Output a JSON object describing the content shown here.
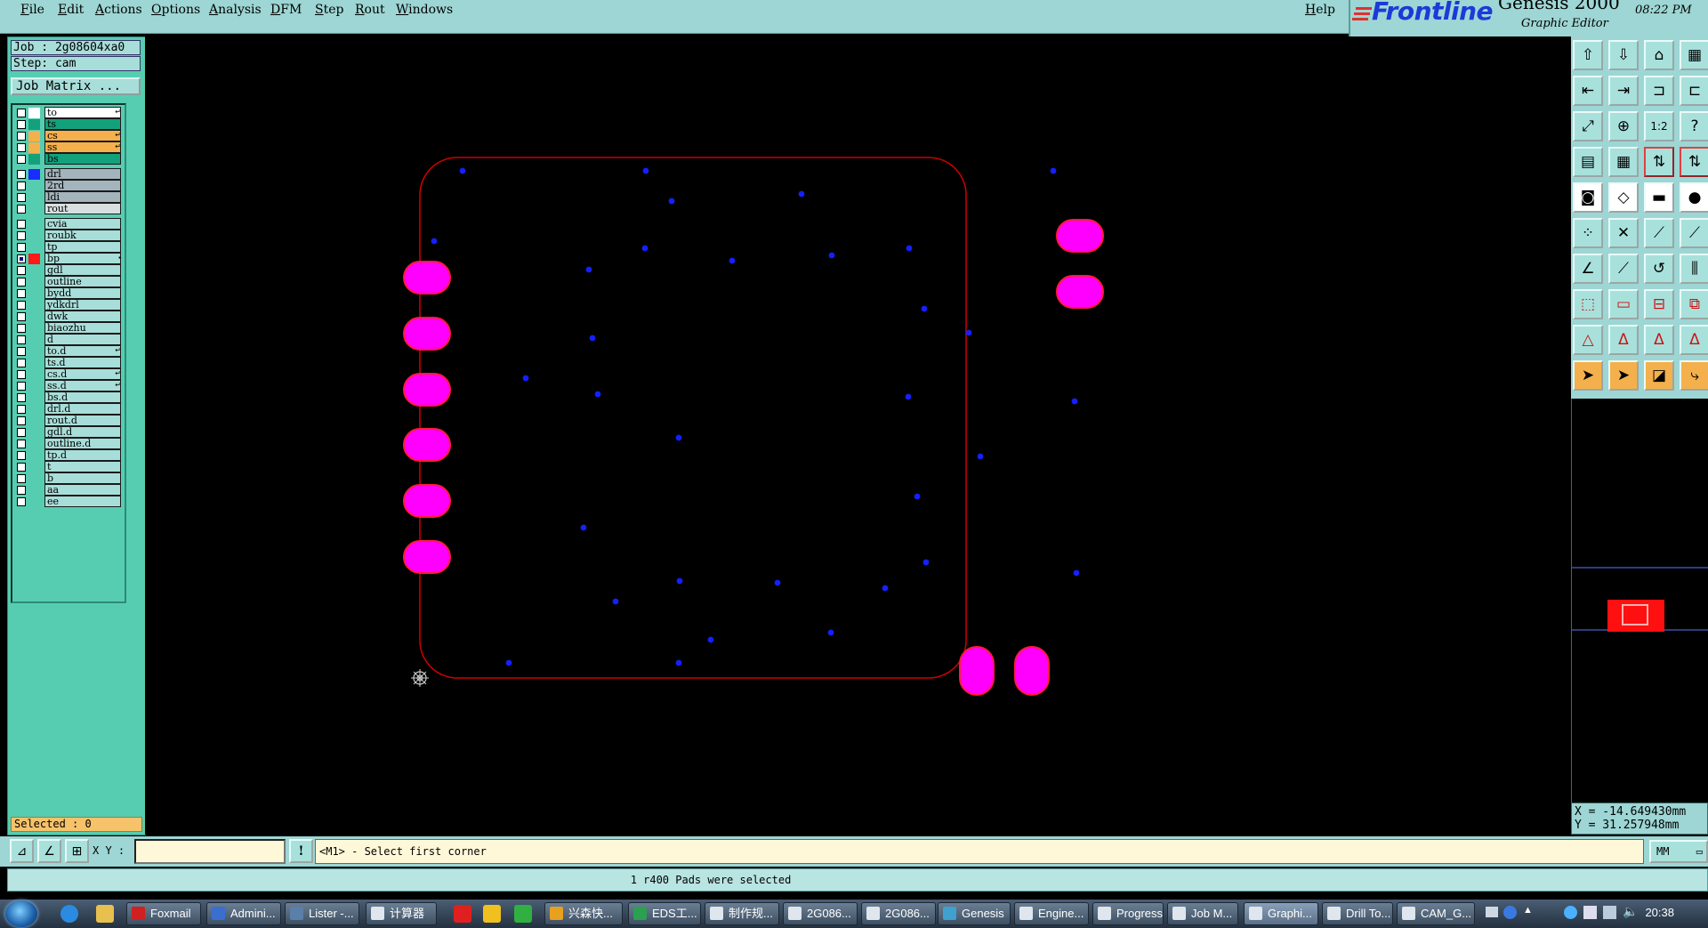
{
  "menu": {
    "items": [
      {
        "label": "File",
        "mnemonic": "F",
        "rest": "ile"
      },
      {
        "label": "Edit",
        "mnemonic": "E",
        "rest": "dit"
      },
      {
        "label": "Actions",
        "mnemonic": "A",
        "rest": "ctions"
      },
      {
        "label": "Options",
        "mnemonic": "O",
        "rest": "ptions"
      },
      {
        "label": "Analysis",
        "mnemonic": "A",
        "rest": "nalysis"
      },
      {
        "label": "DFM",
        "mnemonic": "D",
        "rest": "FM"
      },
      {
        "label": "Step",
        "mnemonic": "S",
        "rest": "tep"
      },
      {
        "label": "Rout",
        "mnemonic": "R",
        "rest": "out"
      },
      {
        "label": "Windows",
        "mnemonic": "W",
        "rest": "indows"
      }
    ],
    "help": {
      "mnemonic": "H",
      "rest": "elp"
    }
  },
  "brand": {
    "logo": "Frontline",
    "product": "Genesis 2000",
    "subtitle": "Graphic Editor",
    "time": "08:22 PM"
  },
  "job": {
    "job_line": "Job : 2g08604xa0",
    "step_line": "Step: cam",
    "matrix_button": "Job Matrix ..."
  },
  "layers": [
    {
      "name": "to",
      "color": "#ffffff",
      "name_bg": "#ffffff",
      "mark": "↵"
    },
    {
      "name": "ts",
      "color": "#13a17c",
      "name_bg": "#13a17c",
      "mark": ""
    },
    {
      "name": "cs",
      "color": "#f4b04c",
      "name_bg": "#f4b04c",
      "mark": "↵"
    },
    {
      "name": "ss",
      "color": "#f4b04c",
      "name_bg": "#f4b04c",
      "mark": "↵"
    },
    {
      "name": "bs",
      "color": "#13a17c",
      "name_bg": "#13a17c",
      "mark": ""
    },
    {
      "name": "drl",
      "color": "#1a2cff",
      "name_bg": "#a4b4bc",
      "mark": "",
      "gap": true
    },
    {
      "name": "2rd",
      "color": "",
      "name_bg": "#a4b4bc",
      "mark": ""
    },
    {
      "name": "ldi",
      "color": "",
      "name_bg": "#a4b4bc",
      "mark": ""
    },
    {
      "name": "rout",
      "color": "",
      "name_bg": "#d9dfe0",
      "mark": ""
    },
    {
      "name": "cvia",
      "color": "",
      "name_bg": "#a8ded9",
      "mark": "",
      "gap": true
    },
    {
      "name": "roubk",
      "color": "",
      "name_bg": "#a8ded9",
      "mark": ""
    },
    {
      "name": "tp",
      "color": "",
      "name_bg": "#a8ded9",
      "mark": ""
    },
    {
      "name": "bp",
      "color": "#ff1a1a",
      "name_bg": "#a8ded9",
      "mark": "▪",
      "checked": true
    },
    {
      "name": "gdl",
      "color": "",
      "name_bg": "#a8ded9",
      "mark": ""
    },
    {
      "name": "outline",
      "color": "",
      "name_bg": "#a8ded9",
      "mark": ""
    },
    {
      "name": "bydd",
      "color": "",
      "name_bg": "#a8ded9",
      "mark": ""
    },
    {
      "name": "ydkdrl",
      "color": "",
      "name_bg": "#a8ded9",
      "mark": ""
    },
    {
      "name": "dwk",
      "color": "",
      "name_bg": "#a8ded9",
      "mark": ""
    },
    {
      "name": "biaozhu",
      "color": "",
      "name_bg": "#a8ded9",
      "mark": ""
    },
    {
      "name": "d",
      "color": "",
      "name_bg": "#a8ded9",
      "mark": ""
    },
    {
      "name": "to.d",
      "color": "",
      "name_bg": "#a8ded9",
      "mark": "↵"
    },
    {
      "name": "ts.d",
      "color": "",
      "name_bg": "#a8ded9",
      "mark": ""
    },
    {
      "name": "cs.d",
      "color": "",
      "name_bg": "#a8ded9",
      "mark": "↵"
    },
    {
      "name": "ss.d",
      "color": "",
      "name_bg": "#a8ded9",
      "mark": "↵"
    },
    {
      "name": "bs.d",
      "color": "",
      "name_bg": "#a8ded9",
      "mark": ""
    },
    {
      "name": "drl.d",
      "color": "",
      "name_bg": "#a8ded9",
      "mark": ""
    },
    {
      "name": "rout.d",
      "color": "",
      "name_bg": "#a8ded9",
      "mark": ""
    },
    {
      "name": "gdl.d",
      "color": "",
      "name_bg": "#a8ded9",
      "mark": ""
    },
    {
      "name": "outline.d",
      "color": "",
      "name_bg": "#a8ded9",
      "mark": ""
    },
    {
      "name": "tp.d",
      "color": "",
      "name_bg": "#a8ded9",
      "mark": ""
    },
    {
      "name": "t",
      "color": "",
      "name_bg": "#a8ded9",
      "mark": ""
    },
    {
      "name": "b",
      "color": "",
      "name_bg": "#a8ded9",
      "mark": ""
    },
    {
      "name": "aa",
      "color": "",
      "name_bg": "#a8ded9",
      "mark": ""
    },
    {
      "name": "ee",
      "color": "",
      "name_bg": "#a8ded9",
      "mark": ""
    }
  ],
  "selected_text": "Selected : 0",
  "colors": {
    "outline": "#d00000",
    "pad_fill": "#ff00ff",
    "pad_border": "#ff1a3a",
    "drill": "#1420ff",
    "overview_mark": "#ff1010"
  },
  "coordinates": {
    "x_line": "X = -14.649430mm",
    "y_line": "Y = 31.257948mm"
  },
  "command": {
    "xy_label": "X Y :",
    "xy_value": "",
    "prompt": "<M1> - Select first corner",
    "units": "MM"
  },
  "status": "1 r400 Pads were selected",
  "taskbar": {
    "tasks": [
      "Foxmail",
      "Admini...",
      "Lister -...",
      "计算器",
      "",
      "",
      "",
      "兴森快...",
      "EDS工...",
      "制作规...",
      "2G086...",
      "2G086...",
      "Genesis",
      "Engine...",
      "Progress",
      "Job M...",
      "Graphi...",
      "Drill To...",
      "CAM_G..."
    ],
    "clock": "20:38"
  },
  "toolbar_icons": [
    "open-job-icon",
    "save-icon",
    "home-icon",
    "window-layout-icon",
    "zoom-prev-icon",
    "zoom-next-icon",
    "zoom-fit-icon",
    "snap-icon",
    "zoom-home-icon",
    "zoom-all-icon",
    "scale-1-2-icon",
    "help-query-icon",
    "layer-display-icon",
    "grid-icon",
    "layer-compare-icon",
    "layer-compare-2-icon",
    "pad-icon",
    "feature-icon",
    "measure-icon",
    "round-pad-icon",
    "connect-icon",
    "cross-icon",
    "line-node-icon",
    "node-icon",
    "angle-icon",
    "slash-icon",
    "arc-icon",
    "text-bar-icon",
    "select-area-icon",
    "minus-icon",
    "dimension-icon",
    "shapes-icon",
    "triangle-alert-icon",
    "triangle-a-icon",
    "triangle-a2-icon",
    "triangle-a3-icon",
    "pointer-icon",
    "pointer-select-icon",
    "lasso-icon",
    "route-path-icon"
  ],
  "pcb": {
    "pads_left_count": 6,
    "pads_right_count": 2,
    "pads_bottom_count": 2,
    "drill_hits": 38
  }
}
